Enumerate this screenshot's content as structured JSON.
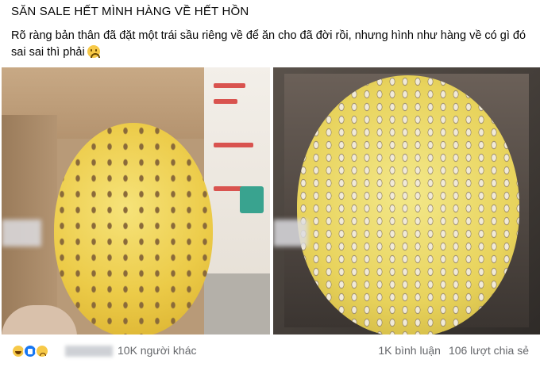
{
  "post": {
    "headline": "SĂN SALE HẾT MÌNH HÀNG VỀ HẾT HỒN",
    "caption": "Rõ ràng bản thân đã đặt một trái sầu riêng về để ăn cho đã đời rồi, nhưng hình như hàng về có gì đó sai sai thì phải",
    "caption_emoji": "sad-face-emoji"
  },
  "photos": [
    {
      "name": "durian-with-sunflower-seeds-in-box-left",
      "icon": "photo"
    },
    {
      "name": "durian-with-sunflower-seeds-in-box-right",
      "icon": "photo"
    }
  ],
  "footer": {
    "reactions": [
      "haha-reaction-icon",
      "like-reaction-icon",
      "sad-reaction-icon"
    ],
    "others_label": "10K người khác",
    "comments_label": "1K bình luận",
    "shares_label": "106 lượt chia sẻ"
  },
  "colors": {
    "text": "#050505",
    "secondary_text": "#65676b",
    "like_blue": "#1877f2",
    "emoji_yellow": "#f7c948"
  }
}
